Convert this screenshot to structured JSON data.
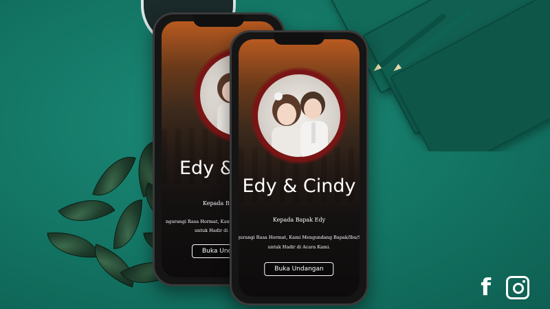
{
  "invitation": {
    "couple_names": "Edy & Cindy",
    "couple_names_cropped": "Edy & C",
    "greeting": "Kepada Bapak Edy",
    "message_line1": "ngurangi Rasa Hormat, Kami Mengundang Bapak/Ibu/Sa",
    "message_line1_cropped": "ngurangi Rasa Hormat, Kami Meng",
    "message_line2": "untuk Hadir di Acara Kami.",
    "message_line2_cropped": "untuk Hadir di Acar",
    "open_button_label": "Buka Undangan",
    "open_button_label_cropped": "Buka Undan"
  },
  "social": {
    "facebook_glyph": "f"
  },
  "icons": [
    "facebook-icon",
    "instagram-icon"
  ],
  "colors": {
    "background": "#137463",
    "frame_ring": "#7a1515",
    "text": "#ffffff"
  }
}
